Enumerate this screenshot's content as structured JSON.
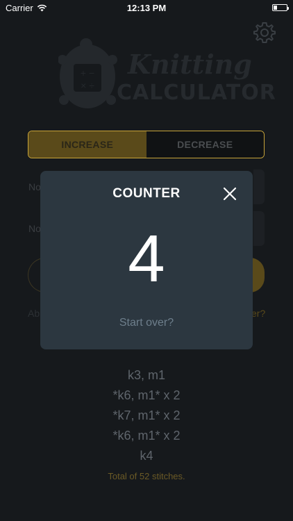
{
  "status_bar": {
    "carrier": "Carrier",
    "time": "12:13 PM"
  },
  "logo": {
    "line1": "Knitting",
    "line2": "CALCULATOR"
  },
  "segment": {
    "increase_label": "INCREASE",
    "decrease_label": "DECREASE",
    "selected": "INCREASE"
  },
  "background": {
    "row1_label": "No",
    "row2_label": "No",
    "about_text": "Ab",
    "over_text": "er?"
  },
  "modal": {
    "title": "COUNTER",
    "count": "4",
    "start_over": "Start over?"
  },
  "pattern": [
    "k3, m1",
    "*k6, m1* x 2",
    "*k7, m1* x 2",
    "*k6, m1* x 2",
    "k4"
  ],
  "total": "Total of 52 stitches.",
  "colors": {
    "accent": "#c9a53a",
    "background": "#16191c",
    "modal": "#2c3740"
  }
}
